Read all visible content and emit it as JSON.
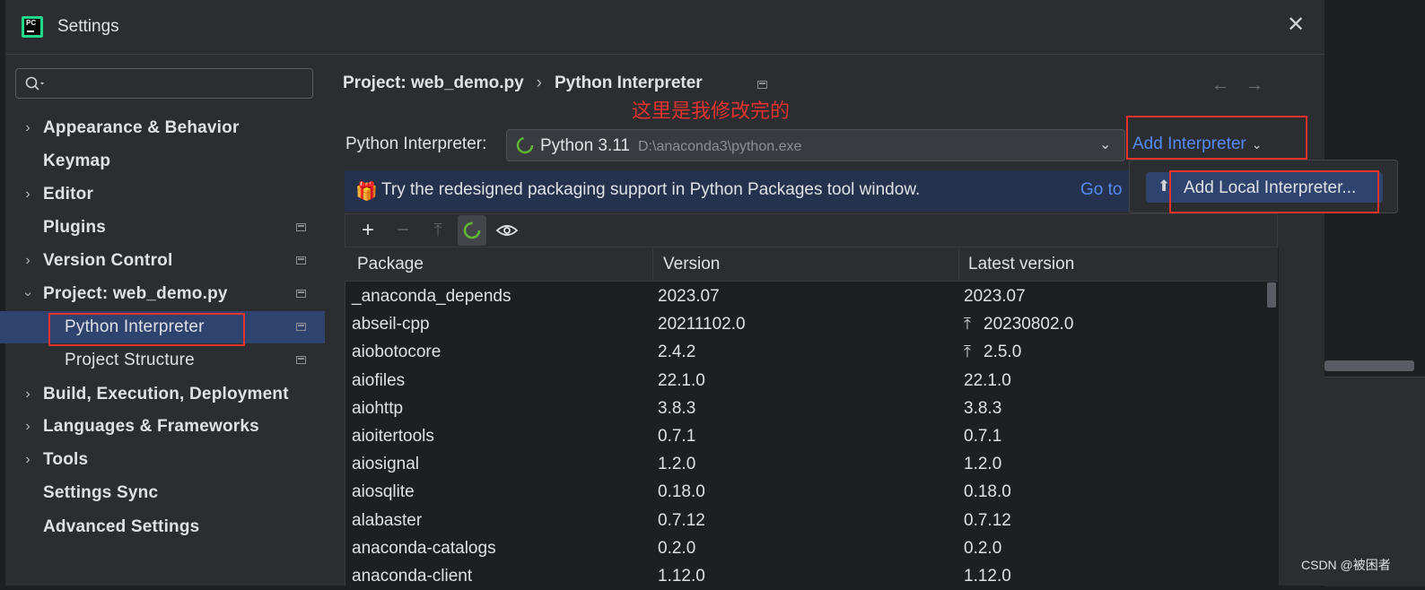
{
  "window": {
    "title": "Settings",
    "app_logo_text": "PC"
  },
  "sidebar": {
    "search_placeholder": "",
    "items": [
      {
        "label": "Appearance & Behavior"
      },
      {
        "label": "Keymap"
      },
      {
        "label": "Editor"
      },
      {
        "label": "Plugins"
      },
      {
        "label": "Version Control"
      },
      {
        "label": "Project: web_demo.py"
      },
      {
        "label": "Python Interpreter"
      },
      {
        "label": "Project Structure"
      },
      {
        "label": "Build, Execution, Deployment"
      },
      {
        "label": "Languages & Frameworks"
      },
      {
        "label": "Tools"
      },
      {
        "label": "Settings Sync"
      },
      {
        "label": "Advanced Settings"
      }
    ]
  },
  "breadcrumb": {
    "parent": "Project: web_demo.py",
    "separator": "›",
    "current": "Python Interpreter"
  },
  "annotation": "这里是我修改完的",
  "interpreter": {
    "label": "Python Interpreter:",
    "name": "Python 3.11",
    "path": "D:\\anaconda3\\python.exe",
    "add_button": "Add Interpreter"
  },
  "banner": {
    "text": "Try the redesigned packaging support in Python Packages tool window.",
    "link": "Go to"
  },
  "popup": {
    "item": "Add Local Interpreter..."
  },
  "table": {
    "headers": [
      "Package",
      "Version",
      "Latest version"
    ],
    "rows": [
      {
        "package": "_anaconda_depends",
        "version": "2023.07",
        "latest": "2023.07",
        "upgrade": false
      },
      {
        "package": "abseil-cpp",
        "version": "20211102.0",
        "latest": "20230802.0",
        "upgrade": true
      },
      {
        "package": "aiobotocore",
        "version": "2.4.2",
        "latest": "2.5.0",
        "upgrade": true
      },
      {
        "package": "aiofiles",
        "version": "22.1.0",
        "latest": "22.1.0",
        "upgrade": false
      },
      {
        "package": "aiohttp",
        "version": "3.8.3",
        "latest": "3.8.3",
        "upgrade": false
      },
      {
        "package": "aioitertools",
        "version": "0.7.1",
        "latest": "0.7.1",
        "upgrade": false
      },
      {
        "package": "aiosignal",
        "version": "1.2.0",
        "latest": "1.2.0",
        "upgrade": false
      },
      {
        "package": "aiosqlite",
        "version": "0.18.0",
        "latest": "0.18.0",
        "upgrade": false
      },
      {
        "package": "alabaster",
        "version": "0.7.12",
        "latest": "0.7.12",
        "upgrade": false
      },
      {
        "package": "anaconda-catalogs",
        "version": "0.2.0",
        "latest": "0.2.0",
        "upgrade": false
      },
      {
        "package": "anaconda-client",
        "version": "1.12.0",
        "latest": "1.12.0",
        "upgrade": false
      }
    ]
  },
  "watermark": "CSDN @被困者",
  "colors": {
    "accent": "#548af7",
    "selection": "#2e436e",
    "annotation_red": "#e5322e"
  }
}
